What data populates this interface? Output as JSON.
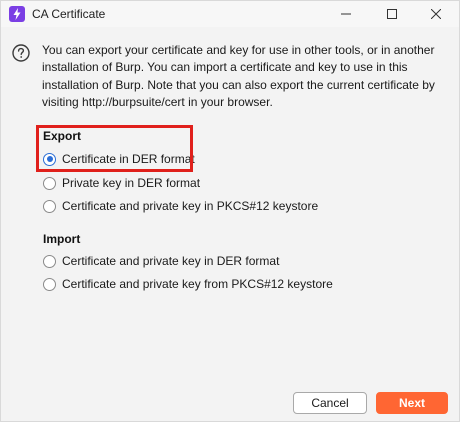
{
  "window": {
    "title": "CA Certificate"
  },
  "description": "You can export your certificate and key for use in other tools, or in another installation of Burp. You can import a certificate and key to use in this installation of Burp. Note that you can also export the current certificate by visiting http://burpsuite/cert in your browser.",
  "export": {
    "title": "Export",
    "options": [
      {
        "label": "Certificate in DER format",
        "checked": true
      },
      {
        "label": "Private key in DER format",
        "checked": false
      },
      {
        "label": "Certificate and private key in PKCS#12 keystore",
        "checked": false
      }
    ]
  },
  "import": {
    "title": "Import",
    "options": [
      {
        "label": "Certificate and private key in DER format",
        "checked": false
      },
      {
        "label": "Certificate and private key from PKCS#12 keystore",
        "checked": false
      }
    ]
  },
  "buttons": {
    "cancel": "Cancel",
    "next": "Next"
  },
  "colors": {
    "accent": "#ff6633",
    "radio_selected": "#2b6ed6",
    "highlight_box": "#e0201b"
  }
}
